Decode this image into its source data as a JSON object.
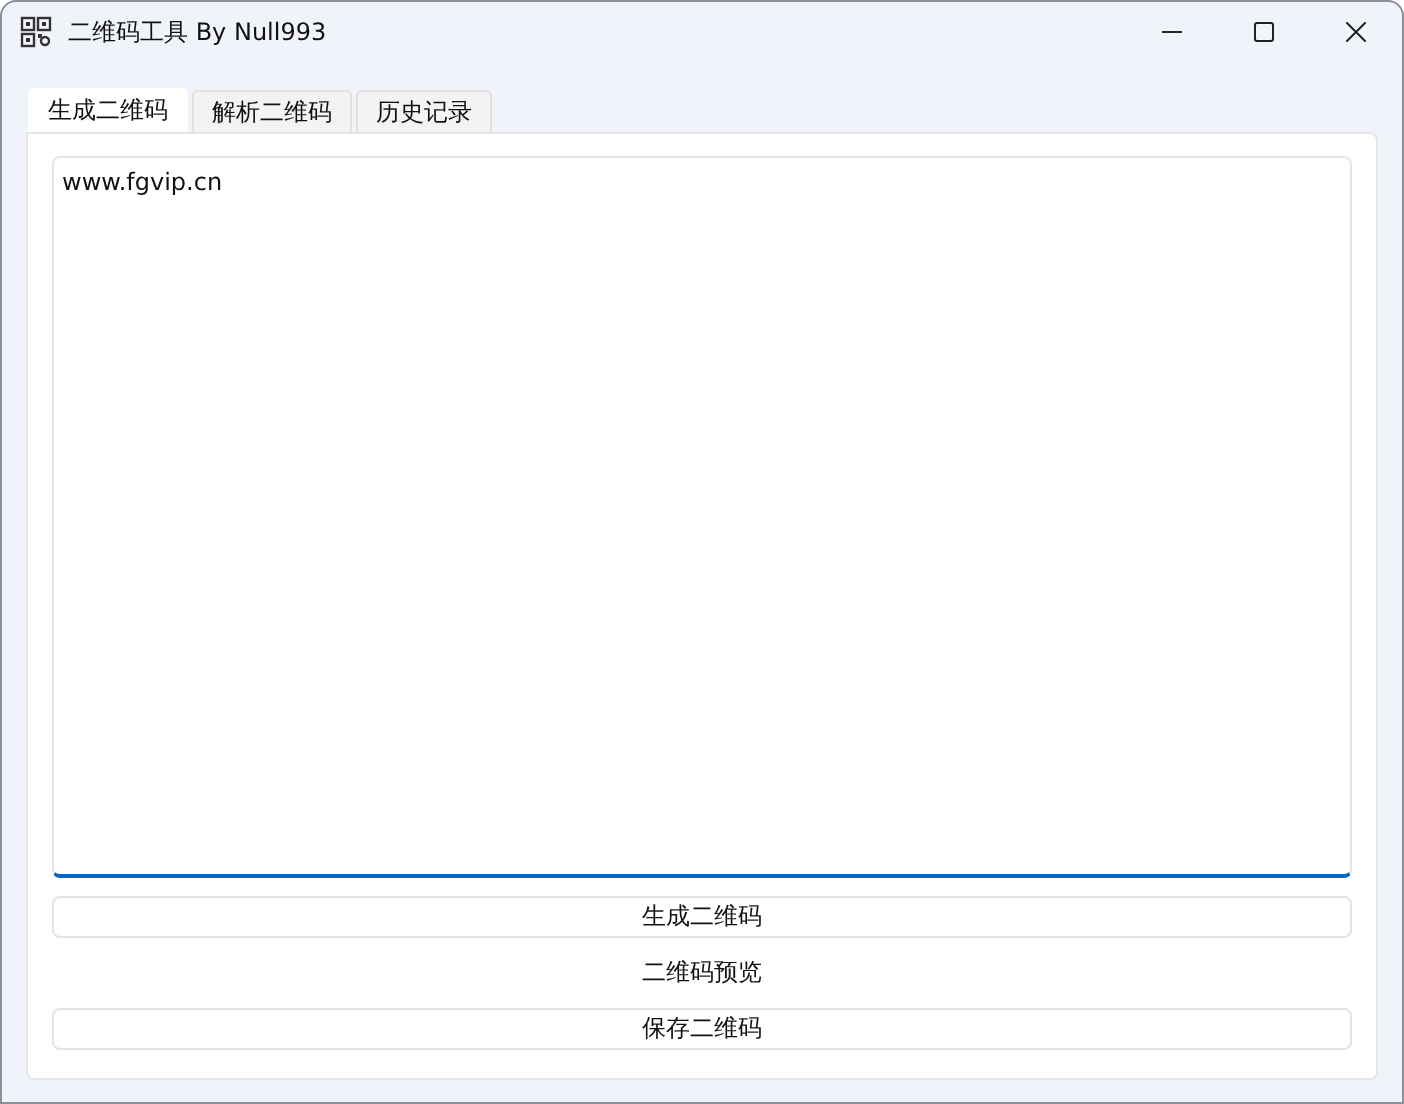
{
  "window": {
    "title": "二维码工具  By Null993"
  },
  "tabs": [
    {
      "label": "生成二维码",
      "selected": true
    },
    {
      "label": "解析二维码",
      "selected": false
    },
    {
      "label": "历史记录",
      "selected": false
    }
  ],
  "input": {
    "value": "www.fgvip.cn"
  },
  "generate_button": "生成二维码",
  "preview_label": "二维码预览",
  "save_button": "保存二维码"
}
